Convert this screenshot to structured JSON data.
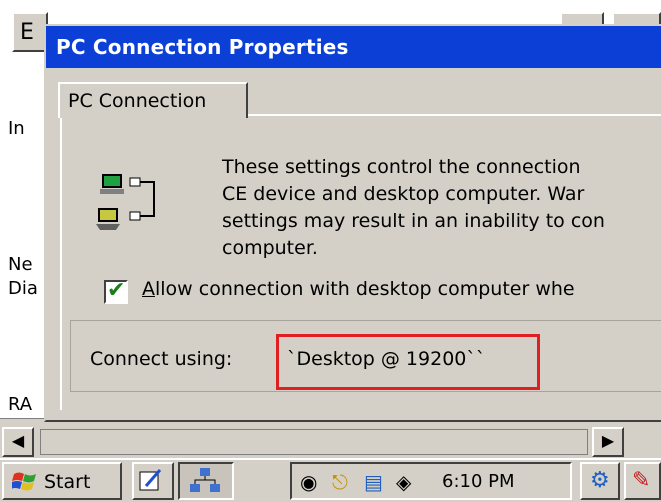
{
  "background_window": {
    "menu_letter": "E",
    "side_texts": [
      "In",
      "Ne",
      "Dia",
      "RA"
    ]
  },
  "dialog": {
    "title": "PC Connection Properties",
    "tabs": [
      {
        "label": "PC Connection",
        "active": true
      }
    ],
    "description": "These settings control the connection\nCE device and desktop computer.  War\nsettings may result in an inability to con\ncomputer.",
    "allow_checkbox": {
      "checked": true,
      "label_accel": "A",
      "label_rest": "llow connection with desktop computer whe"
    },
    "connect_using": {
      "label": "Connect using:",
      "value": "`Desktop @ 19200``"
    }
  },
  "taskbar": {
    "start_label": "Start",
    "clock": "6:10 PM"
  },
  "colors": {
    "titlebar": "#0c3fd6",
    "face": "#d4d0c8",
    "highlight_box": "#e02020",
    "check": "#1a7f1a"
  }
}
